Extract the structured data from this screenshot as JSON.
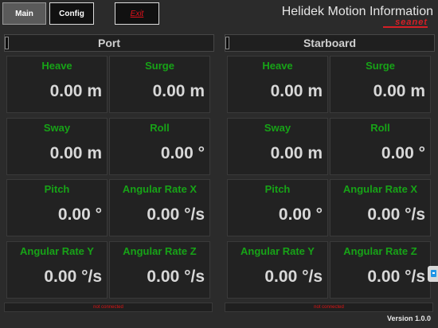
{
  "toolbar": {
    "main_label": "Main",
    "config_label": "Config",
    "exit_label": "Exit"
  },
  "header": {
    "title": "Helidek Motion Information",
    "brand": "seanet"
  },
  "port": {
    "title": "Port",
    "status": "not connected",
    "cards": [
      {
        "label": "Heave",
        "value": "0.00 m"
      },
      {
        "label": "Surge",
        "value": "0.00 m"
      },
      {
        "label": "Sway",
        "value": "0.00 m"
      },
      {
        "label": "Roll",
        "value": "0.00 °"
      },
      {
        "label": "Pitch",
        "value": "0.00 °"
      },
      {
        "label": "Angular Rate X",
        "value": "0.00 °/s"
      },
      {
        "label": "Angular Rate Y",
        "value": "0.00 °/s"
      },
      {
        "label": "Angular Rate Z",
        "value": "0.00 °/s"
      }
    ]
  },
  "starboard": {
    "title": "Starboard",
    "status": "not connected",
    "cards": [
      {
        "label": "Heave",
        "value": "0.00 m"
      },
      {
        "label": "Surge",
        "value": "0.00 m"
      },
      {
        "label": "Sway",
        "value": "0.00 m"
      },
      {
        "label": "Roll",
        "value": "0.00 °"
      },
      {
        "label": "Pitch",
        "value": "0.00 °"
      },
      {
        "label": "Angular Rate X",
        "value": "0.00 °/s"
      },
      {
        "label": "Angular Rate Y",
        "value": "0.00 °/s"
      },
      {
        "label": "Angular Rate Z",
        "value": "0.00 °/s"
      }
    ]
  },
  "footer": {
    "version": "Version 1.0.0"
  },
  "side_tab": {
    "icon": "side-panel-icon"
  }
}
